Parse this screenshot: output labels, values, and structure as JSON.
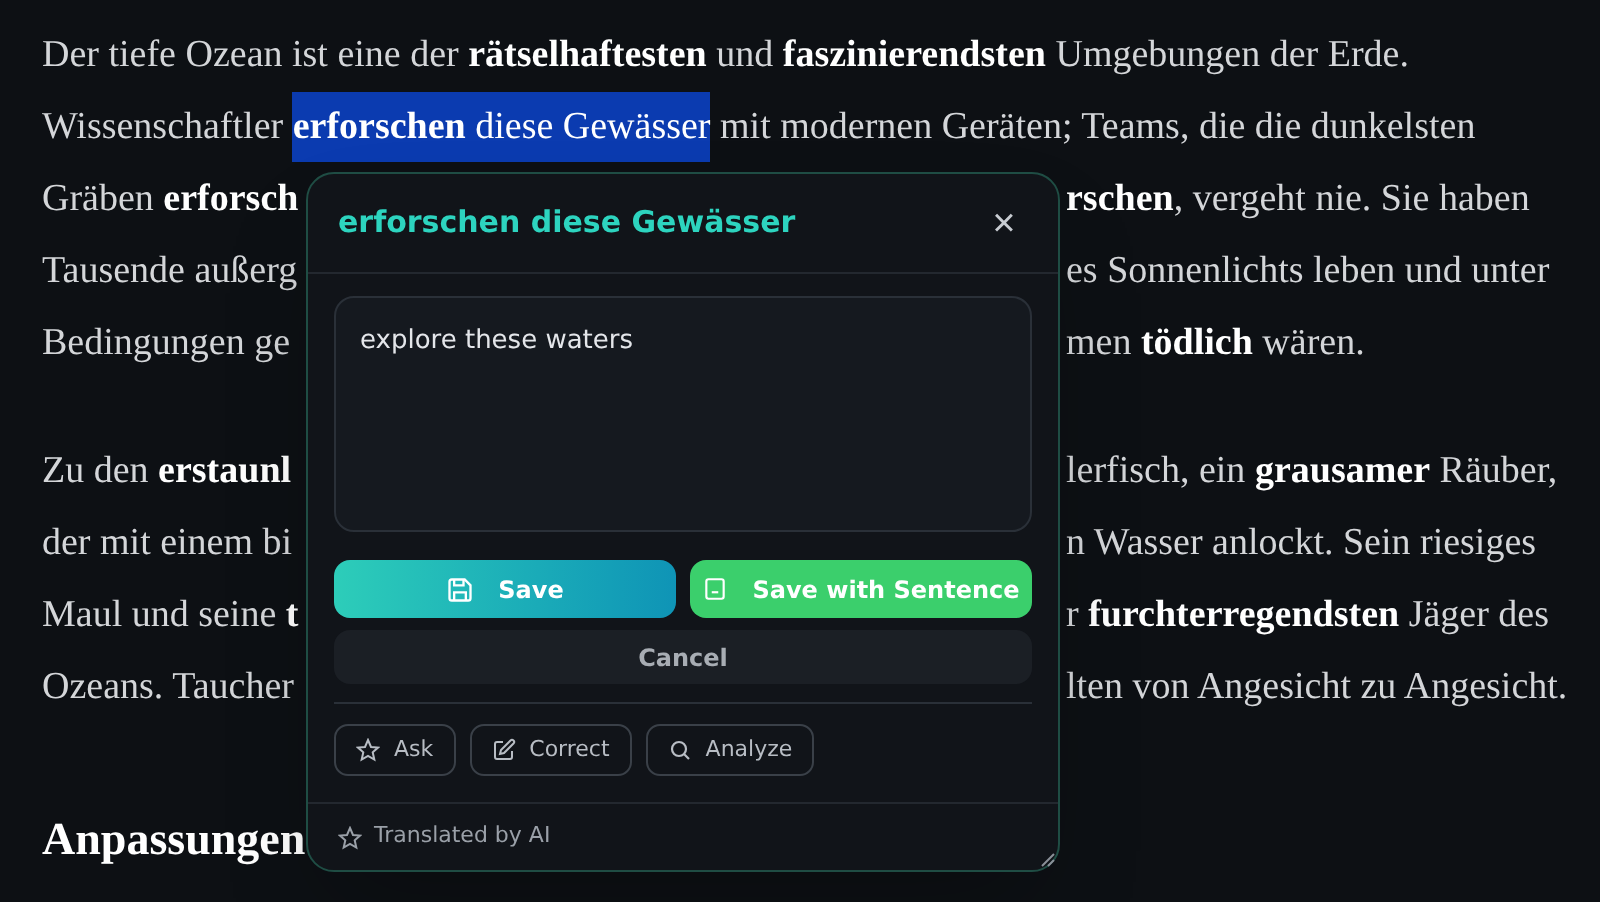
{
  "article": {
    "paragraphs": [
      {
        "lines": [
          {
            "kind": "full",
            "segments": [
              {
                "text": "Der tiefe Ozean ist eine der **rätselhaftesten** und **faszinierendsten** Umgebungen der Erde.",
                "highlighted": false
              }
            ]
          },
          {
            "kind": "full",
            "segments": [
              {
                "text": "Wissenschaftler ",
                "highlighted": false
              },
              {
                "text": "**erforschen** diese Gewässer",
                "highlighted": true
              },
              {
                "text": " mit modernen Geräten; Teams, die die dunkelsten",
                "highlighted": false
              }
            ]
          },
          {
            "kind": "split",
            "left": "Gräben **erforsch**",
            "right": "**rschen**, vergeht nie. Sie haben"
          },
          {
            "kind": "split",
            "left": "Tausende außerg",
            "right": "es Sonnenlichts leben und unter"
          },
          {
            "kind": "split",
            "left": "Bedingungen ge",
            "right": "men **tödlich** wären."
          }
        ]
      },
      {
        "lines": [
          {
            "kind": "split",
            "left": "Zu den **erstaunl**",
            "right": "lerfisch, ein **grausamer** Räuber,"
          },
          {
            "kind": "split",
            "left": "der mit einem bi",
            "right": "n Wasser anlockt. Sein riesiges"
          },
          {
            "kind": "split",
            "left": "Maul und seine **t**",
            "right": "r **furchterregendsten** Jäger des"
          },
          {
            "kind": "split",
            "left": "Ozeans. Taucher",
            "right": "lten von Angesicht zu Angesicht."
          }
        ]
      }
    ],
    "heading": "Anpassungen"
  },
  "popup": {
    "title": "erforschen diese Gewässer",
    "close": "×",
    "translation": "explore these waters",
    "buttons": [
      {
        "kind": "save",
        "label": "Save"
      },
      {
        "kind": "save_sentence",
        "label": "Save with Sentence"
      },
      {
        "kind": "cancel",
        "label": "Cancel"
      }
    ],
    "actions": [
      {
        "kind": "ask",
        "label": "Ask"
      },
      {
        "kind": "correct",
        "label": "Correct"
      },
      {
        "kind": "analyze",
        "label": "Analyze"
      }
    ],
    "footer": "Translated by AI"
  }
}
